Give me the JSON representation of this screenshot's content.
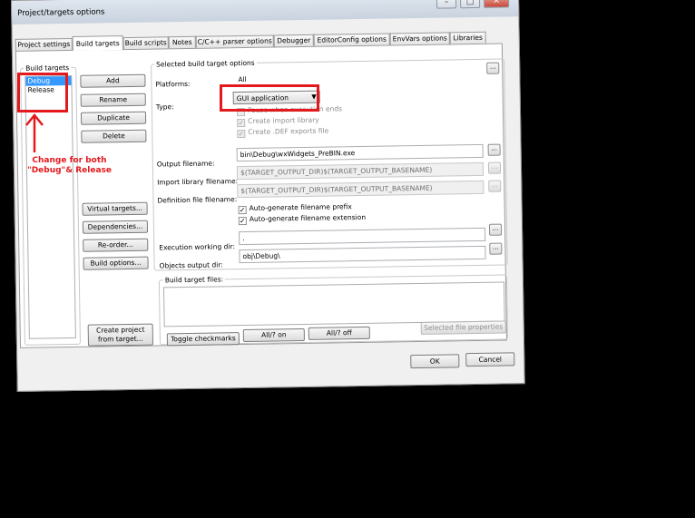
{
  "window": {
    "title": "Project/targets options",
    "controls": {
      "minimize": "–",
      "maximize": "□",
      "close": "✕"
    }
  },
  "tabs": [
    {
      "label": "Project settings",
      "active": false
    },
    {
      "label": "Build targets",
      "active": true
    },
    {
      "label": "Build scripts",
      "active": false
    },
    {
      "label": "Notes",
      "active": false
    },
    {
      "label": "C/C++ parser options",
      "active": false
    },
    {
      "label": "Debugger",
      "active": false
    },
    {
      "label": "EditorConfig options",
      "active": false
    },
    {
      "label": "EnvVars options",
      "active": false
    },
    {
      "label": "Libraries",
      "active": false
    }
  ],
  "targets": {
    "group_label": "Build targets",
    "items": [
      {
        "label": "Debug",
        "selected": true
      },
      {
        "label": "Release",
        "selected": false
      }
    ],
    "buttons": {
      "add": "Add",
      "rename": "Rename",
      "duplicate": "Duplicate",
      "delete": "Delete",
      "virtual": "Virtual targets...",
      "dependencies": "Dependencies...",
      "reorder": "Re-order...",
      "build_options": "Build options...",
      "create_project_1": "Create project",
      "create_project_2": "from target..."
    }
  },
  "options": {
    "group_label": "Selected build target options",
    "platforms_label": "Platforms:",
    "platforms_value": "All",
    "type_label": "Type:",
    "type_value": "GUI application",
    "pause_label": "Pause when execution ends",
    "create_import_label": "Create import library",
    "create_def_label": "Create .DEF exports file",
    "output_label": "Output filename:",
    "output_value": "bin\\Debug\\wxWidgets_PreBIN.exe",
    "import_lib_label": "Import library filename:",
    "import_lib_value": "$(TARGET_OUTPUT_DIR)$(TARGET_OUTPUT_BASENAME)",
    "def_label": "Definition file filename:",
    "def_value": "$(TARGET_OUTPUT_DIR)$(TARGET_OUTPUT_BASENAME)",
    "auto_prefix_label": "Auto-generate filename prefix",
    "auto_ext_label": "Auto-generate filename extension",
    "exec_dir_label": "Execution working dir:",
    "exec_dir_value": ".",
    "obj_dir_label": "Objects output dir:",
    "obj_dir_value": "obj\\Debug\\",
    "dots": "..."
  },
  "files": {
    "group_label": "Build target files:",
    "toggle": "Toggle checkmarks",
    "all_on": "All/? on",
    "all_off": "All/? off",
    "file_props": "Selected file properties"
  },
  "footer": {
    "ok": "OK",
    "cancel": "Cancel"
  },
  "annotation": {
    "line1": "Change for both",
    "line2": "\"Debug\"& Release",
    "color": "#e3191d"
  }
}
